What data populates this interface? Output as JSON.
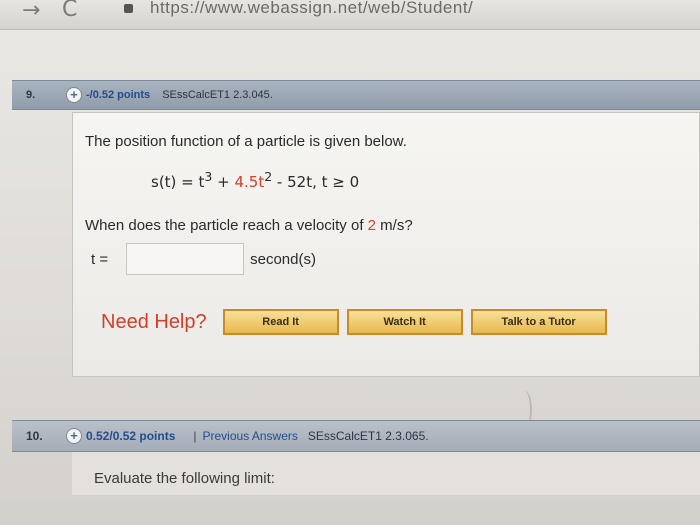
{
  "browser": {
    "back_icon": "arrow-right-icon",
    "reload_icon": "reload-icon",
    "url": "https://www.webassign.net/web/Student/"
  },
  "questions": [
    {
      "number": "9.",
      "points": "-/0.52 points",
      "course": "SEssCalcET1 2.3.045.",
      "prompt": "The position function of a particle is given below.",
      "formula": {
        "lhs": "s(t) = t",
        "exp3": "3",
        "plus": " + ",
        "coef": "4.5",
        "t2": "t",
        "exp2": "2",
        "rest": " - 52t, t ≥ 0"
      },
      "question_pre": "When does the particle reach a velocity of ",
      "velocity": "2",
      "question_post": " m/s?",
      "answer_label": "t =",
      "answer_value": "",
      "answer_unit": "second(s)",
      "need_help": "Need Help?",
      "buttons": {
        "read": "Read It",
        "watch": "Watch It",
        "tutor": "Talk to a Tutor"
      }
    },
    {
      "number": "10.",
      "points": "0.52/0.52 points",
      "separator": "|",
      "previous_answers": "Previous Answers",
      "course": "SEssCalcET1 2.3.065.",
      "prompt": "Evaluate the following limit:"
    }
  ],
  "colors": {
    "accent_red": "#d1402b",
    "link_blue": "#234d8a",
    "button_gold": "#e8b84d"
  }
}
